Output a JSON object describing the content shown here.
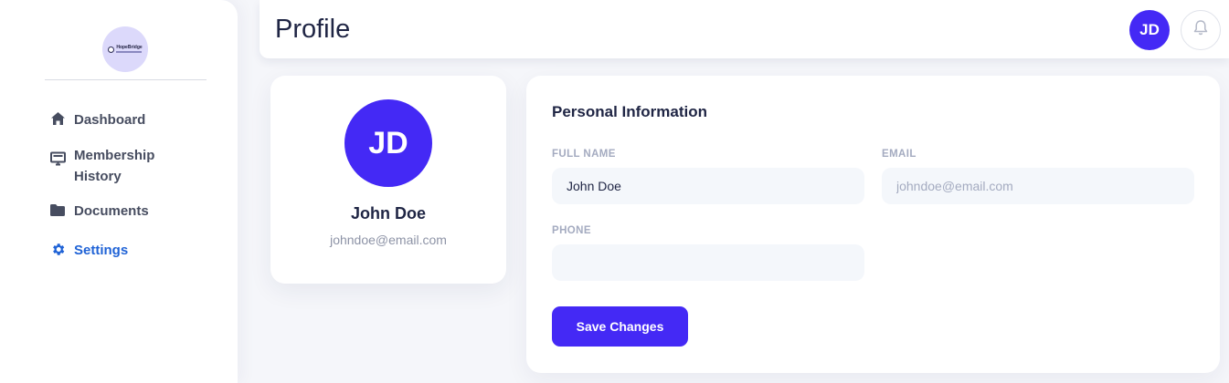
{
  "brand": {
    "logo_text": "HopeBridge",
    "logo_icon": "logo-icon"
  },
  "sidebar": {
    "items": [
      {
        "label": "Dashboard",
        "icon": "home-icon",
        "active": false
      },
      {
        "label": "Membership History",
        "icon": "monitor-icon",
        "active": false
      },
      {
        "label": "Documents",
        "icon": "folder-icon",
        "active": false
      },
      {
        "label": "Settings",
        "icon": "gear-icon",
        "active": true
      }
    ]
  },
  "header": {
    "title": "Profile",
    "avatar_initials": "JD",
    "notification_icon": "bell-icon"
  },
  "profile": {
    "initials": "JD",
    "name": "John Doe",
    "email": "johndoe@email.com"
  },
  "form": {
    "title": "Personal Information",
    "full_name": {
      "label": "FULL NAME",
      "value": "John Doe"
    },
    "email": {
      "label": "EMAIL",
      "placeholder": "johndoe@email.com"
    },
    "phone": {
      "label": "PHONE",
      "value": ""
    },
    "save_label": "Save Changes"
  },
  "colors": {
    "accent": "#4429f5",
    "active_nav": "#2063d6",
    "text_dark": "#1f2544",
    "text_muted": "#8d93a6",
    "input_bg": "#f4f7fb"
  }
}
